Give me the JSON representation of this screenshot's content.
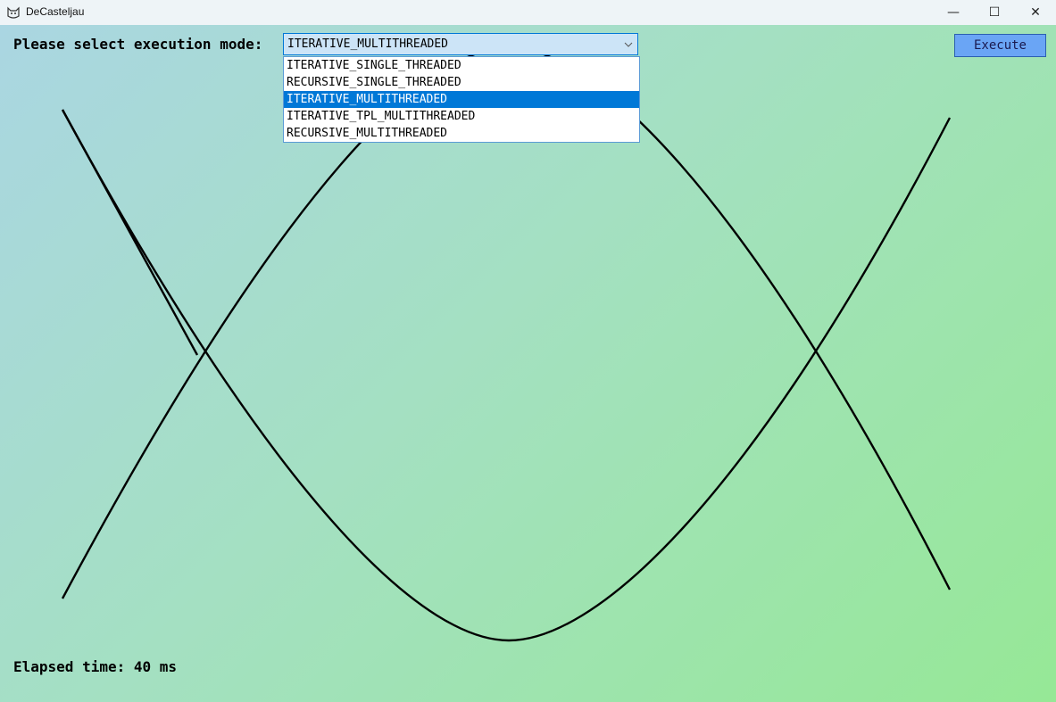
{
  "window": {
    "title": "DeCasteljau",
    "app_icon": "cat-icon",
    "controls": {
      "minimize": "—",
      "maximize": "☐",
      "close": "✕"
    }
  },
  "toolbar": {
    "mode_label": "Please select execution mode:",
    "selected_mode": "ITERATIVE_MULTITHREADED",
    "execute_label": "Execute"
  },
  "modes": [
    "ITERATIVE_SINGLE_THREADED",
    "RECURSIVE_SINGLE_THREADED",
    "ITERATIVE_MULTITHREADED",
    "ITERATIVE_TPL_MULTITHREADED",
    "RECURSIVE_MULTITHREADED"
  ],
  "status": {
    "elapsed": "Elapsed time: 40 ms"
  },
  "colors": {
    "curve": "#000000",
    "selected_item": "#0078d7",
    "execute_button": "#6aa5f5"
  }
}
